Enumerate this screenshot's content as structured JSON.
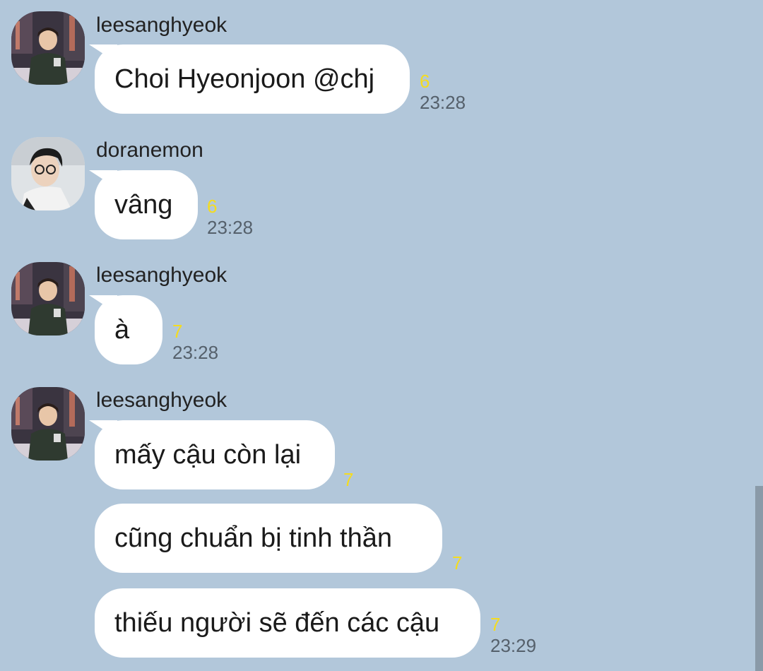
{
  "messages": [
    {
      "sender": "leesanghyeok",
      "bubbles": [
        {
          "text": "Choi Hyeonjoon @chj",
          "unread": "6",
          "time": "23:28"
        }
      ]
    },
    {
      "sender": "doranemon",
      "bubbles": [
        {
          "text": "vâng",
          "unread": "6",
          "time": "23:28"
        }
      ]
    },
    {
      "sender": "leesanghyeok",
      "bubbles": [
        {
          "text": "à",
          "unread": "7",
          "time": "23:28"
        }
      ]
    },
    {
      "sender": "leesanghyeok",
      "bubbles": [
        {
          "text": "mấy cậu còn lại",
          "unread": "7",
          "time": ""
        },
        {
          "text": "cũng chuẩn bị tinh thần",
          "unread": "7",
          "time": ""
        },
        {
          "text": "thiếu người sẽ đến các cậu",
          "unread": "7",
          "time": "23:29"
        }
      ]
    }
  ],
  "colors": {
    "background": "#b2c7da",
    "bubble": "#ffffff",
    "unread": "#f5dc1e",
    "time": "#55606b"
  }
}
